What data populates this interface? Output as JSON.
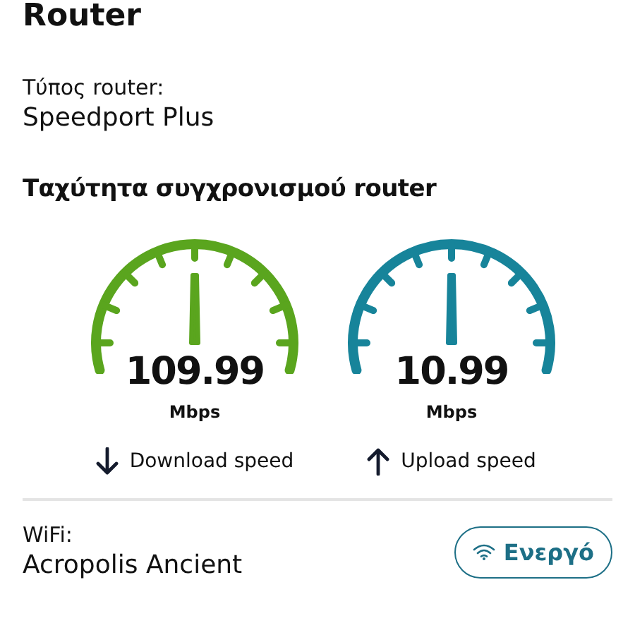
{
  "title": "Router",
  "router_type": {
    "label": "Τύπος router:",
    "value": "Speedport Plus"
  },
  "sync_speed": {
    "heading": "Ταχύτητα συγχρονισμού router",
    "gauges": [
      {
        "value": "109.99",
        "unit": "Mbps",
        "color": "#5aa51e",
        "kind": "down",
        "label": "Download speed"
      },
      {
        "value": "10.99",
        "unit": "Mbps",
        "color": "#17849a",
        "kind": "up",
        "label": "Upload speed"
      }
    ]
  },
  "wifi": {
    "label": "WiFi:",
    "value": "Acropolis Ancient",
    "status": "Ενεργό"
  }
}
